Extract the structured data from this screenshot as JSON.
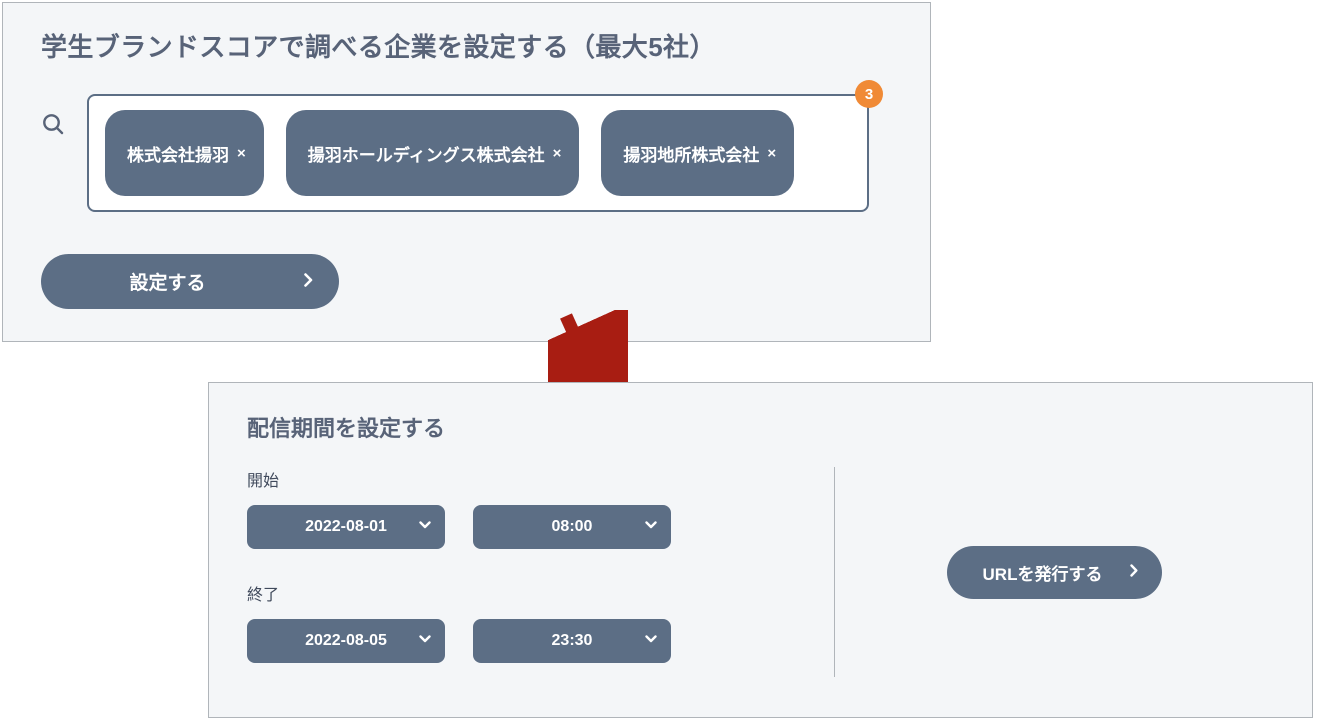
{
  "top": {
    "title": "学生ブランドスコアで調べる企業を設定する（最大5社）",
    "chips": [
      "株式会社揚羽",
      "揚羽ホールディングス株式会社",
      "揚羽地所株式会社"
    ],
    "chip_count_badge": "3",
    "submit_label": "設定する"
  },
  "bottom": {
    "title": "配信期間を設定する",
    "start_label": "開始",
    "end_label": "終了",
    "start_date": "2022-08-01",
    "start_time": "08:00",
    "end_date": "2022-08-05",
    "end_time": "23:30",
    "url_button_label": "URLを発行する"
  }
}
